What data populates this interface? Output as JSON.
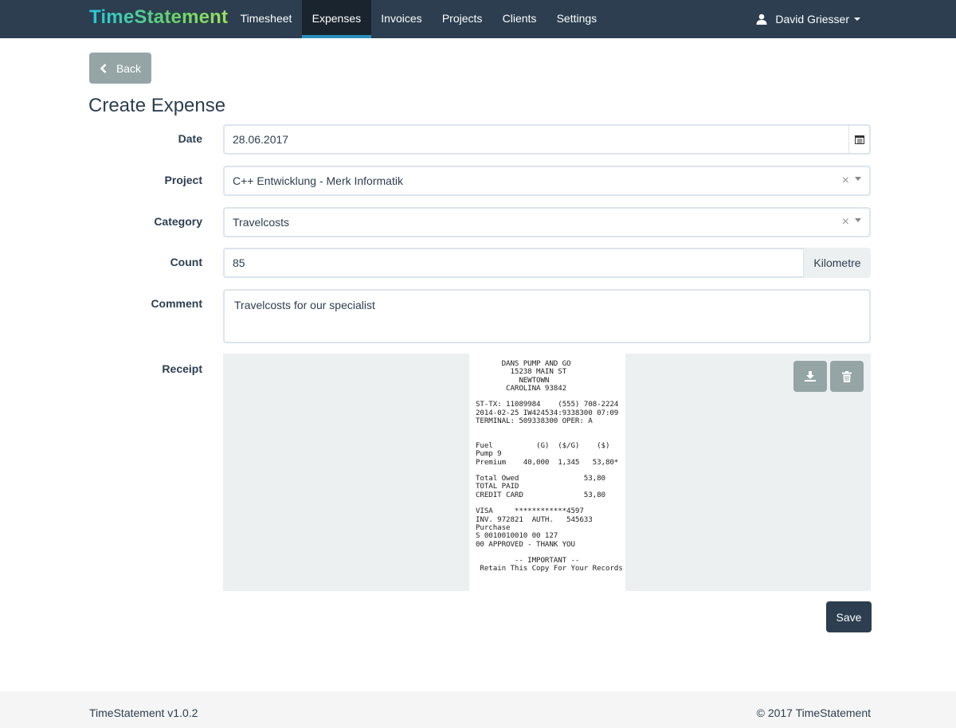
{
  "app": {
    "brand": "TimeStatement"
  },
  "nav": {
    "items": [
      {
        "label": "Timesheet"
      },
      {
        "label": "Expenses",
        "active": true
      },
      {
        "label": "Invoices"
      },
      {
        "label": "Projects"
      },
      {
        "label": "Clients"
      },
      {
        "label": "Settings"
      }
    ],
    "user": "David Griesser"
  },
  "back_label": "Back",
  "page_title": "Create Expense",
  "form": {
    "date": {
      "label": "Date",
      "value": "28.06.2017"
    },
    "project": {
      "label": "Project",
      "value": "C++ Entwicklung - Merk Informatik"
    },
    "category": {
      "label": "Category",
      "value": "Travelcosts"
    },
    "count": {
      "label": "Count",
      "value": "85",
      "unit": "Kilometre"
    },
    "comment": {
      "label": "Comment",
      "value": "Travelcosts for our specialist"
    },
    "receipt": {
      "label": "Receipt",
      "text": "      DANS PUMP AND GO\n        15238 MAIN ST\n          NEWTOWN\n       CAROLINA 93842\n\nST-TX: 11089984    (555) 708-2224\n2014-02-25 IW424534:9338300 07:09\nTERMINAL: 509338300 OPER: A\n\n\nFuel          (G)  ($/G)    ($)\nPump 9\nPremium    40,000  1,345   53,80*\n\nTotal Owed               53,80\nTOTAL PAID\nCREDIT CARD              53,80\n\nVISA     ************4597\nINV. 972821  AUTH.   545633\nPurchase\nS 0010010010 00 127\n00 APPROVED - THANK YOU\n\n         -- IMPORTANT --\n Retain This Copy For Your Records"
    }
  },
  "save_label": "Save",
  "footer": {
    "left": "TimeStatement v1.0.2",
    "right": "© 2017 TimeStatement"
  },
  "icons": [
    "user-icon",
    "chevron-left-icon",
    "calendar-icon",
    "clear-icon",
    "dropdown-arrow-icon",
    "download-icon",
    "trash-icon"
  ]
}
